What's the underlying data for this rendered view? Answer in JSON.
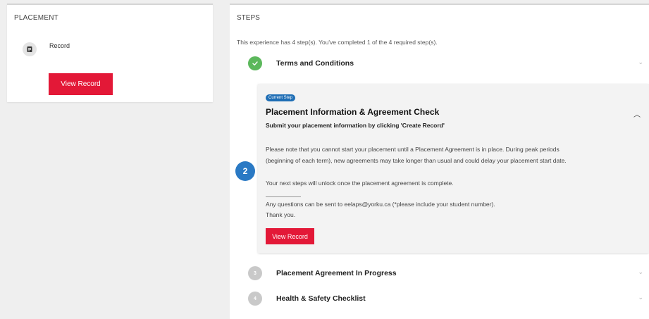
{
  "placement": {
    "title": "PLACEMENT",
    "record_label": "Record",
    "button": "View Record"
  },
  "steps": {
    "title": "STEPS",
    "intro": "This experience has 4 step(s). You've completed 1 of the 4 required step(s).",
    "completed": [
      {
        "title": "Terms and Conditions",
        "icon": "check-icon"
      }
    ],
    "current": {
      "number": "2",
      "badge": "Current Step",
      "title": "Placement Information & Agreement Check",
      "subtitle": "Submit your placement information by clicking 'Create Record'",
      "para1_line1": "Please note that you cannot start your placement until a Placement Agreement is in place. During peak periods",
      "para1_line2": "(beginning of each term), new agreements may take longer than usual and could delay your placement start date.",
      "para2": "Your next steps will unlock once the placement agreement is complete.",
      "para3": "Any questions can be sent to eelaps@yorku.ca (*please include your student number).",
      "para4": "Thank you.",
      "button": "View Record"
    },
    "upcoming": [
      {
        "number": "3",
        "title": "Placement Agreement In Progress"
      },
      {
        "number": "4",
        "title": "Health & Safety Checklist"
      }
    ]
  },
  "colors": {
    "accent_red": "#e31837",
    "accent_blue": "#2a79c4",
    "complete_green": "#5cb85c",
    "pending_grey": "#c9c9c9"
  }
}
